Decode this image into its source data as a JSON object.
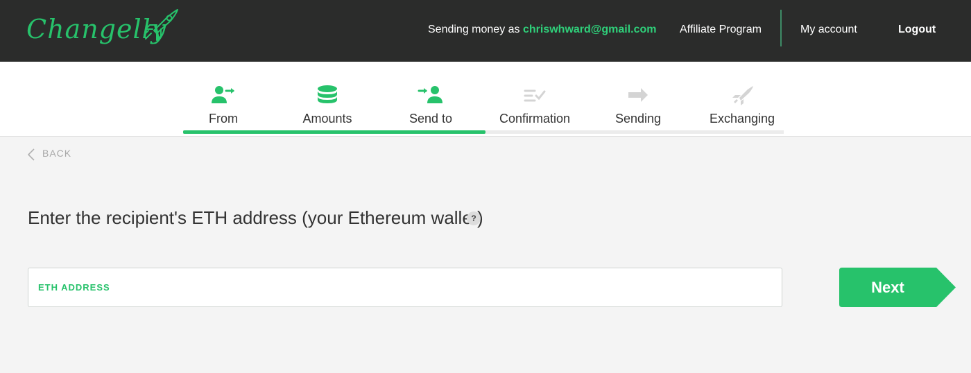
{
  "brand": {
    "logo_text": "Changelly",
    "logo_icon": "rocket-icon",
    "accent_color": "#27c26b"
  },
  "header": {
    "sending_prefix": "Sending money as",
    "email": "chriswhward@gmail.com",
    "nav": {
      "affiliate": "Affiliate Program",
      "account": "My account",
      "logout": "Logout"
    }
  },
  "steps": [
    {
      "label": "From",
      "icon": "user-arrow-out-icon",
      "state": "done"
    },
    {
      "label": "Amounts",
      "icon": "coin-stack-icon",
      "state": "done"
    },
    {
      "label": "Send to",
      "icon": "arrow-user-in-icon",
      "state": "current"
    },
    {
      "label": "Confirmation",
      "icon": "checklist-icon",
      "state": "upcoming"
    },
    {
      "label": "Sending",
      "icon": "arrow-right-icon",
      "state": "upcoming"
    },
    {
      "label": "Exchanging",
      "icon": "exchange-rocket-icon",
      "state": "upcoming"
    }
  ],
  "progress": {
    "completed_steps": 3,
    "total_steps": 6
  },
  "back_label": "BACK",
  "prompt": "Enter the recipient's ETH address (your Ethereum wallet)",
  "help_label": "?",
  "address_field": {
    "label": "ETH ADDRESS",
    "value": "",
    "placeholder": ""
  },
  "next_label": "Next"
}
